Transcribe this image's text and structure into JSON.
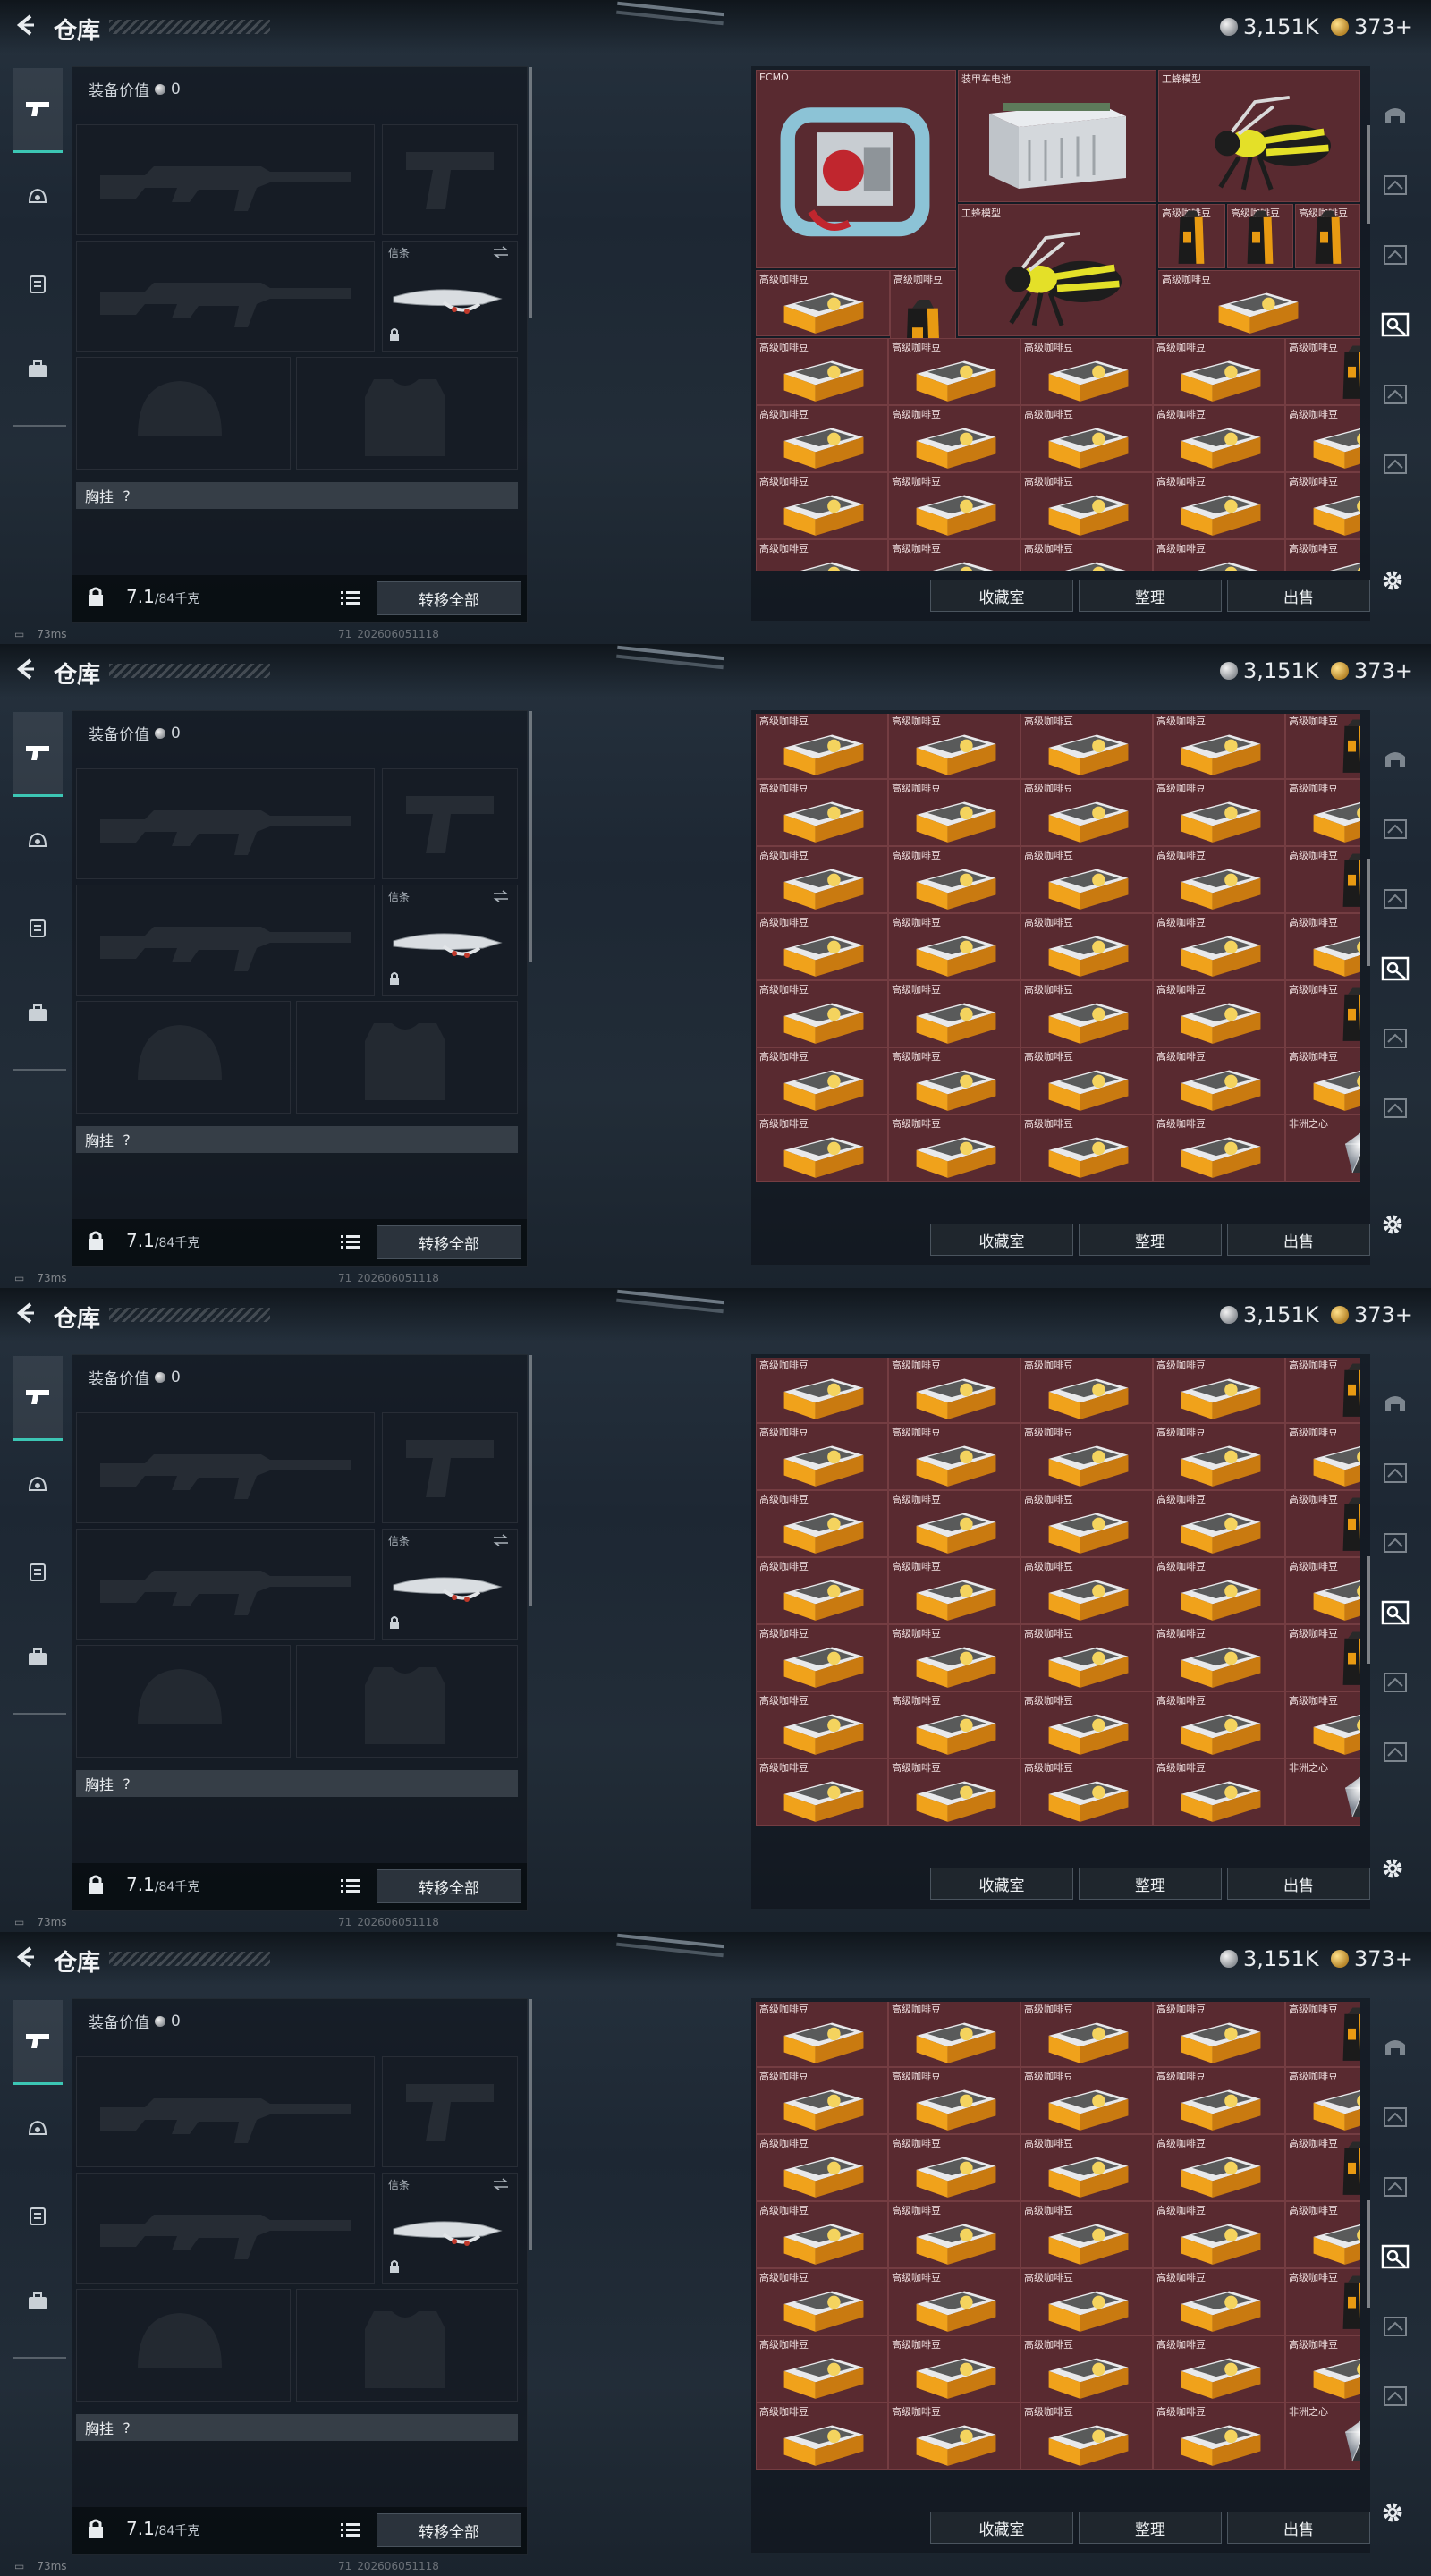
{
  "panels": [
    {
      "header": {
        "title": "仓库",
        "silver": "3,151K",
        "gold": "373+"
      },
      "equipment": {
        "value_label": "装备价值",
        "value": "0",
        "melee_label": "信条",
        "chest_label": "胸挂",
        "chest_value": "?"
      },
      "footer": {
        "weight": "7.1",
        "weight_max": "/84千克",
        "transfer_label": "转移全部"
      },
      "buttons": {
        "collection": "收藏室",
        "sort": "整理",
        "sell": "出售"
      },
      "status": {
        "ping": "73ms",
        "build": "71_202606051118"
      },
      "stash_mode": "top"
    },
    {
      "header": {
        "title": "仓库",
        "silver": "3,151K",
        "gold": "373+"
      },
      "equipment": {
        "value_label": "装备价值",
        "value": "0",
        "melee_label": "信条",
        "chest_label": "胸挂",
        "chest_value": "?"
      },
      "footer": {
        "weight": "7.1",
        "weight_max": "/84千克",
        "transfer_label": "转移全部"
      },
      "buttons": {
        "collection": "收藏室",
        "sort": "整理",
        "sell": "出售"
      },
      "status": {
        "ping": "73ms",
        "build": "71_202606051118"
      },
      "stash_mode": "scrolled"
    },
    {
      "header": {
        "title": "仓库",
        "silver": "3,151K",
        "gold": "373+"
      },
      "equipment": {
        "value_label": "装备价值",
        "value": "0",
        "melee_label": "信条",
        "chest_label": "胸挂",
        "chest_value": "?"
      },
      "footer": {
        "weight": "7.1",
        "weight_max": "/84千克",
        "transfer_label": "转移全部"
      },
      "buttons": {
        "collection": "收藏室",
        "sort": "整理",
        "sell": "出售"
      },
      "status": {
        "ping": "73ms",
        "build": "71_202606051118"
      },
      "stash_mode": "bottom"
    },
    {
      "header": {
        "title": "仓库",
        "silver": "3,151K",
        "gold": "373+"
      },
      "equipment": {
        "value_label": "装备价值",
        "value": "0",
        "melee_label": "信条",
        "chest_label": "胸挂",
        "chest_value": "?"
      },
      "footer": {
        "weight": "7.1",
        "weight_max": "/84千克",
        "transfer_label": "转移全部"
      },
      "buttons": {
        "collection": "收藏室",
        "sort": "整理",
        "sell": "出售"
      },
      "status": {
        "ping": "73ms",
        "build": "71_202606051118"
      },
      "stash_mode": "bottom"
    }
  ],
  "item_names": {
    "ecmo": "ECMO",
    "battery": "装甲车电池",
    "wasp": "工蜂模型",
    "coffee": "高级咖啡豆",
    "heart": "非洲之心"
  },
  "colors": {
    "accent": "#3cc6b4",
    "item_bg": "#592a30"
  },
  "icons": [
    "back-arrow-icon",
    "silver-coin-icon",
    "gold-coin-icon",
    "gun-icon",
    "helmet-icon",
    "backpack-icon",
    "briefcase-icon",
    "swap-icon",
    "lock-icon",
    "list-icon",
    "gear-icon",
    "vehicle-icon",
    "weapon-slot-icon"
  ]
}
